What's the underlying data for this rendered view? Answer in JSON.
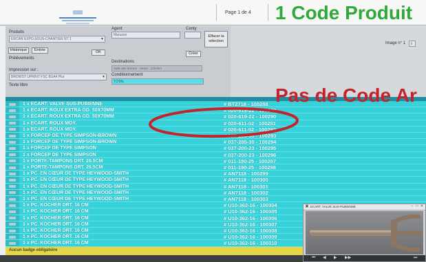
{
  "page_header": {
    "page_indicator": "Page 1 de 4"
  },
  "annotations": {
    "code_produit_label": "1 Code Produit",
    "pas_de_code_label": "Pas de Code Ar",
    "green": "#2fa83c",
    "red": "#c4232b"
  },
  "form": {
    "produits_label": "Produits",
    "produits_value": "ERCAN EXPO.SOUS-CHANTIER NT 1",
    "historique_label": "Historique",
    "entree_label": "Entrée",
    "ok_label": "OK",
    "prelevements_label": "Prélèvements",
    "impression_label": "Impression sur :",
    "printer_value": "BROWST UPRINT FSC 8GA4 Plur",
    "texte_libre_label": "Texte libre",
    "agent_label": "Agent",
    "agent_value": "Maruson",
    "centy_label": "Centy",
    "effacer_label": "Effacer la sélection",
    "creer_label": "Créer",
    "destinations_label": "Destinations",
    "destination_value": "Salle des lésions - Heure : 13h46m",
    "conditionnement_label": "Conditionnement",
    "conditionnement_value": "TOTAL",
    "image_label": "Image n° 1"
  },
  "table": {
    "rows": [
      {
        "description": "1 x ECART. VALVE SUS-PUBIENNE",
        "code": "# BT2718 - 100288"
      },
      {
        "description": "1 x ECART. ROUX EXTRA GD. 50X70MM",
        "code": "# 020-619-22 - 100289"
      },
      {
        "description": "1 x ECART. ROUX EXTRA GD. 50X70MM",
        "code": "# 020-619-22 - 100290"
      },
      {
        "description": "1 x ECART. ROUX MOY.",
        "code": "# 020-611-02 - 100291"
      },
      {
        "description": "1 x ECART. ROUX MOY.",
        "code": "# 020-611-02 - 100292"
      },
      {
        "description": "1 x FORCEP DE TYPE SIMPSON-BROWN",
        "code": "# 037-285-30 - 100293"
      },
      {
        "description": "1 x FORCEP DE TYPE SIMPSON-BROWN",
        "code": "# 037-285-30 - 100294"
      },
      {
        "description": "1 x FORCEP DE TYPE SIMPSON",
        "code": "# 037-200-23 - 100295"
      },
      {
        "description": "1 x FORCEP DE TYPE SIMPSON",
        "code": "# 037-200-23 - 100296"
      },
      {
        "description": "1 x PORTE-TAMPONS DRT. 26.5CM",
        "code": "# 011-190-25 - 100297"
      },
      {
        "description": "1 x PORTE-TAMPONS DRT. 26.5CM",
        "code": "# 011-190-25 - 100298"
      },
      {
        "description": "1 x PC. EN CŒUR DE TYPE HEYWOOD-SMITH",
        "code": "# AN7118 - 100299"
      },
      {
        "description": "1 x PC. EN CŒUR DE TYPE HEYWOOD-SMITH",
        "code": "# AN7118 - 100300"
      },
      {
        "description": "1 x PC. EN CŒUR DE TYPE HEYWOOD-SMITH",
        "code": "# AN7118 - 100301"
      },
      {
        "description": "1 x PC. EN CŒUR DE TYPE HEYWOOD-SMITH",
        "code": "# AN7118 - 100302"
      },
      {
        "description": "1 x PC. EN CŒUR DE TYPE HEYWOOD-SMITH",
        "code": "# AN7118 - 100303"
      },
      {
        "description": "1 x PC. KOCHER DRT. 16 CM",
        "code": "# U10-362-16 - 100304"
      },
      {
        "description": "1 x PC. KOCHER DRT. 16 CM",
        "code": "# U10-362-16 - 100305"
      },
      {
        "description": "1 x PC. KOCHER DRT. 16 CM",
        "code": "# U10-362-16 - 100306"
      },
      {
        "description": "1 x PC. KOCHER DRT. 16 CM",
        "code": "# U10-362-16 - 100307"
      },
      {
        "description": "1 x PC. KOCHER DRT. 16 CM",
        "code": "# U10-362-16 - 100308"
      },
      {
        "description": "1 x PC. KOCHER DRT. 16 CM",
        "code": "# U10-362-16 - 100309"
      },
      {
        "description": "1 x PC. KOCHER DRT. 16 CM",
        "code": "# U10-362-16 - 100310"
      }
    ]
  },
  "status_bar": {
    "badge_text": "Aucun badge obligatoire"
  },
  "preview": {
    "title": "ECART. VALVE SUS-PUBIENNE",
    "toolbar_icons": [
      "first-icon",
      "prev-icon",
      "play-icon",
      "next-icon",
      "last-icon"
    ]
  },
  "colors": {
    "row_cyan": "#37d1d9",
    "header_teal": "#1f8ea0",
    "status_yellow": "#e5d548"
  }
}
